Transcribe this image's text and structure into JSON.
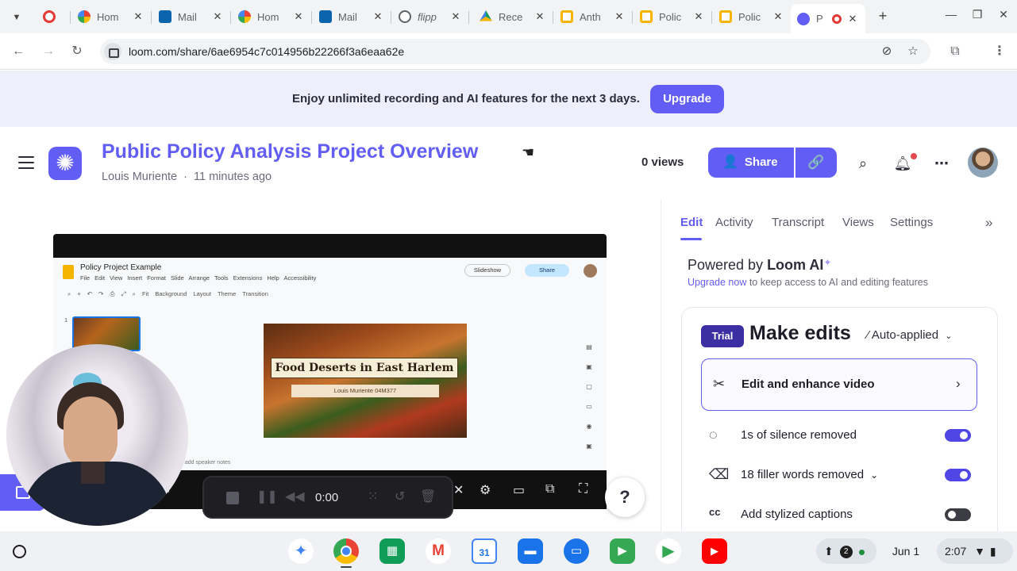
{
  "browser": {
    "tabs": [
      {
        "title": "",
        "favicon_color": "#e53935"
      },
      {
        "title": "Hom",
        "favicon_color": "#4285f4"
      },
      {
        "title": "Mail",
        "favicon_color": "#0a64ad"
      },
      {
        "title": "Hom",
        "favicon_color": "#4285f4"
      },
      {
        "title": "Mail",
        "favicon_color": "#0a64ad"
      },
      {
        "title": "flipp",
        "favicon_color": "#5f6368"
      },
      {
        "title": "Rece",
        "favicon_color": "#0f9d58"
      },
      {
        "title": "Anth",
        "favicon_color": "#f4b400"
      },
      {
        "title": "Polic",
        "favicon_color": "#f4b400"
      },
      {
        "title": "Polic",
        "favicon_color": "#f4b400"
      },
      {
        "title": "P",
        "favicon_color": "#625df5"
      }
    ],
    "url": "loom.com/share/6ae6954c7c014956b22266f3a6eaa62e"
  },
  "banner": {
    "message": "Enjoy unlimited recording and AI features for the next 3 days.",
    "button": "Upgrade"
  },
  "header": {
    "title": "Public Policy Analysis Project Overview",
    "author": "Louis Muriente",
    "separator": "·",
    "time_ago": "11 minutes ago",
    "views": "0 views",
    "share_label": "Share"
  },
  "video": {
    "slides_doc_title": "Policy Project Example",
    "slides_menu": "File  Edit  View  Insert  Format  Slide  Arrange  Tools  Extensions  Help  Accessibility",
    "slides_toolbar": "Fit   Background   Layout   Theme   Transition",
    "slideshow_label": "Slideshow",
    "slides_share_label": "Share",
    "slide_number": "1",
    "slide_title": "Food Deserts in East Harlem",
    "slide_subtitle": "Louis Muriente 04M377",
    "speaker_notes_hint": "n add speaker notes",
    "record_time": "0:00",
    "help_label": "?"
  },
  "panel": {
    "tabs": [
      "Edit",
      "Activity",
      "Transcript",
      "Views",
      "Settings"
    ],
    "powered_prefix": "Powered by ",
    "powered_brand": "Loom AI",
    "upgrade_link": "Upgrade now",
    "upgrade_rest": " to keep access to AI and editing features",
    "trial_badge": "Trial",
    "card_title": "Make edits",
    "auto_applied": "Auto-applied",
    "enhance_label": "Edit and enhance video",
    "options": [
      {
        "label": "1s of silence removed",
        "on": true
      },
      {
        "label": "18 filler words removed",
        "on": true
      },
      {
        "label": "Add stylized captions",
        "on": false
      }
    ]
  },
  "shelf": {
    "calendar_day": "31",
    "notification_count": "2",
    "date": "Jun 1",
    "time": "2:07"
  },
  "colors": {
    "loom_purple": "#625df5",
    "banner_bg": "#efeefb",
    "trial_badge": "#3b2fa3"
  }
}
